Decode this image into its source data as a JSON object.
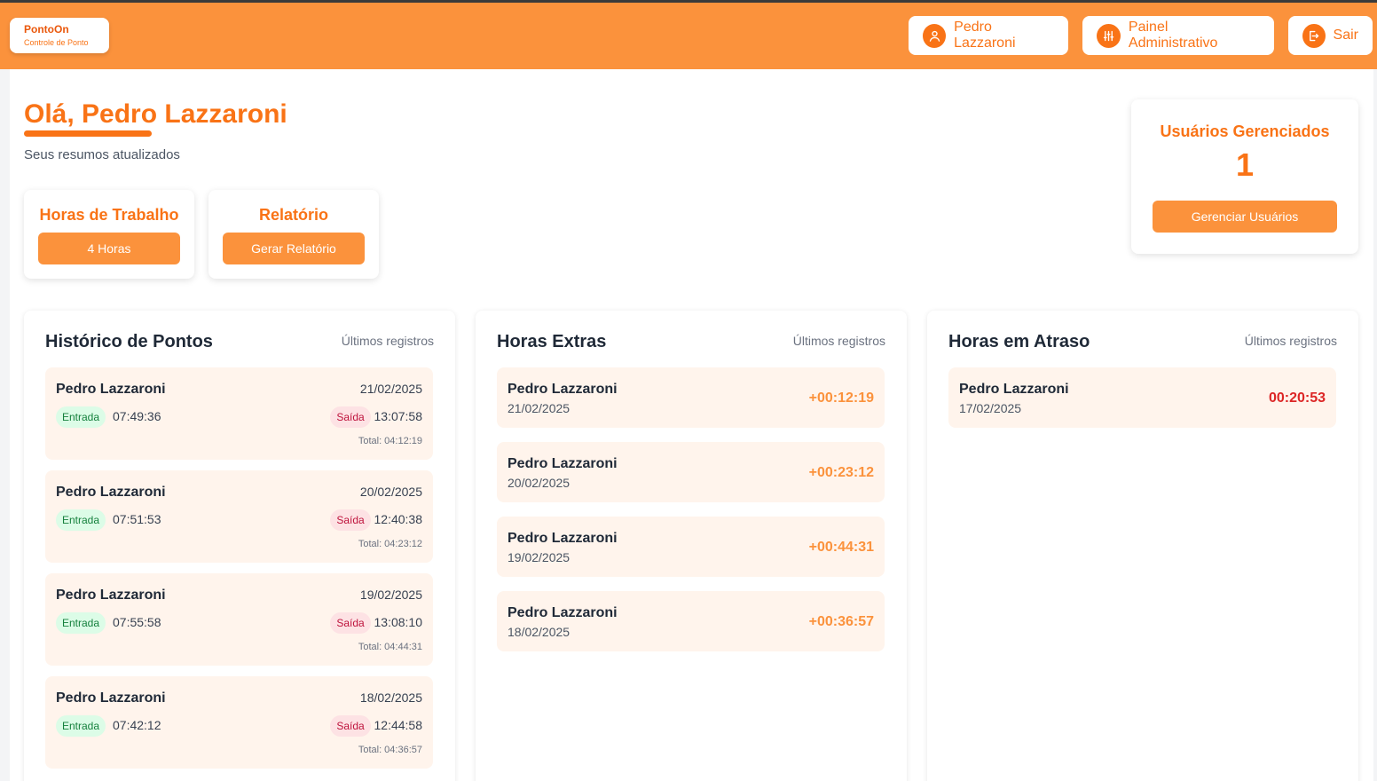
{
  "brand": {
    "name": "PontoOn",
    "subtitle": "Controle de Ponto"
  },
  "header": {
    "user_label": "Pedro Lazzaroni",
    "admin_label": "Painel Administrativo",
    "logout_label": "Sair"
  },
  "greeting": {
    "title": "Olá, Pedro Lazzaroni",
    "subtitle": "Seus resumos atualizados"
  },
  "work_hours": {
    "title": "Horas de Trabalho",
    "button": "4 Horas"
  },
  "report": {
    "title": "Relatório",
    "button": "Gerar Relatório"
  },
  "managed_users": {
    "title": "Usuários Gerenciados",
    "count": "1",
    "button": "Gerenciar Usuários"
  },
  "history": {
    "title": "Histórico de Pontos",
    "hint": "Últimos registros",
    "entries": [
      {
        "name": "Pedro Lazzaroni",
        "date": "21/02/2025",
        "in_label": "Entrada",
        "in_time": "07:49:36",
        "out_label": "Saída",
        "out_time": "13:07:58",
        "total": "Total: 04:12:19"
      },
      {
        "name": "Pedro Lazzaroni",
        "date": "20/02/2025",
        "in_label": "Entrada",
        "in_time": "07:51:53",
        "out_label": "Saída",
        "out_time": "12:40:38",
        "total": "Total: 04:23:12"
      },
      {
        "name": "Pedro Lazzaroni",
        "date": "19/02/2025",
        "in_label": "Entrada",
        "in_time": "07:55:58",
        "out_label": "Saída",
        "out_time": "13:08:10",
        "total": "Total: 04:44:31"
      },
      {
        "name": "Pedro Lazzaroni",
        "date": "18/02/2025",
        "in_label": "Entrada",
        "in_time": "07:42:12",
        "out_label": "Saída",
        "out_time": "12:44:58",
        "total": "Total: 04:36:57"
      }
    ]
  },
  "extra": {
    "title": "Horas Extras",
    "hint": "Últimos registros",
    "entries": [
      {
        "name": "Pedro Lazzaroni",
        "date": "21/02/2025",
        "value": "+00:12:19"
      },
      {
        "name": "Pedro Lazzaroni",
        "date": "20/02/2025",
        "value": "+00:23:12"
      },
      {
        "name": "Pedro Lazzaroni",
        "date": "19/02/2025",
        "value": "+00:44:31"
      },
      {
        "name": "Pedro Lazzaroni",
        "date": "18/02/2025",
        "value": "+00:36:57"
      }
    ]
  },
  "late": {
    "title": "Horas em Atraso",
    "hint": "Últimos registros",
    "entries": [
      {
        "name": "Pedro Lazzaroni",
        "date": "17/02/2025",
        "value": "00:20:53"
      }
    ]
  },
  "colors": {
    "accent": "#f97316",
    "header_bg": "#fb923c",
    "extra_value": "#fb923c",
    "late_value": "#dc2626",
    "item_bg": "#fff4ec"
  }
}
